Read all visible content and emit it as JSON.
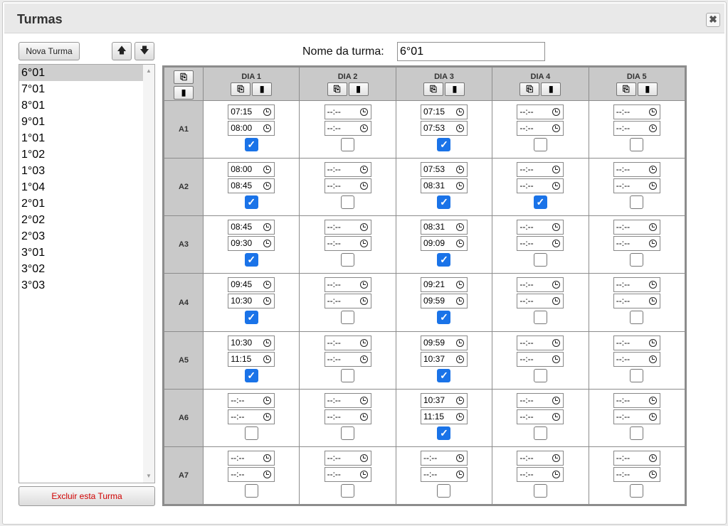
{
  "dialog": {
    "title": "Turmas",
    "close_icon": "✖"
  },
  "buttons": {
    "nova": "Nova Turma",
    "up": "🡅",
    "down": "🡇",
    "excluir": "Excluir esta Turma"
  },
  "list": {
    "items": [
      "6°01",
      "7°01",
      "8°01",
      "9°01",
      "1°01",
      "1°02",
      "1°03",
      "1°04",
      "2°01",
      "2°02",
      "2°03",
      "3°01",
      "3°02",
      "3°03"
    ],
    "selected_index": 0
  },
  "nome": {
    "label": "Nome da turma:",
    "value": "6°01"
  },
  "icons": {
    "copy": "⎘",
    "paste": "▮",
    "scroll_up": "▲",
    "scroll_down": "▼"
  },
  "colors": {
    "checkbox_checked": "#1a73e8",
    "header_bg": "#c9c9c9",
    "delete_text": "#d00000"
  },
  "grid": {
    "days": [
      "DIA 1",
      "DIA 2",
      "DIA 3",
      "DIA 4",
      "DIA 5"
    ],
    "rows": [
      {
        "label": "A1",
        "cells": [
          {
            "start": "07:15",
            "end": "08:00",
            "checked": true
          },
          {
            "start": "--:--",
            "end": "--:--",
            "checked": false
          },
          {
            "start": "07:15",
            "end": "07:53",
            "checked": true
          },
          {
            "start": "--:--",
            "end": "--:--",
            "checked": false
          },
          {
            "start": "--:--",
            "end": "--:--",
            "checked": false
          }
        ]
      },
      {
        "label": "A2",
        "cells": [
          {
            "start": "08:00",
            "end": "08:45",
            "checked": true
          },
          {
            "start": "--:--",
            "end": "--:--",
            "checked": false
          },
          {
            "start": "07:53",
            "end": "08:31",
            "checked": true
          },
          {
            "start": "--:--",
            "end": "--:--",
            "checked": true
          },
          {
            "start": "--:--",
            "end": "--:--",
            "checked": false
          }
        ]
      },
      {
        "label": "A3",
        "cells": [
          {
            "start": "08:45",
            "end": "09:30",
            "checked": true
          },
          {
            "start": "--:--",
            "end": "--:--",
            "checked": false
          },
          {
            "start": "08:31",
            "end": "09:09",
            "checked": true
          },
          {
            "start": "--:--",
            "end": "--:--",
            "checked": false
          },
          {
            "start": "--:--",
            "end": "--:--",
            "checked": false
          }
        ]
      },
      {
        "label": "A4",
        "cells": [
          {
            "start": "09:45",
            "end": "10:30",
            "checked": true
          },
          {
            "start": "--:--",
            "end": "--:--",
            "checked": false
          },
          {
            "start": "09:21",
            "end": "09:59",
            "checked": true
          },
          {
            "start": "--:--",
            "end": "--:--",
            "checked": false
          },
          {
            "start": "--:--",
            "end": "--:--",
            "checked": false
          }
        ]
      },
      {
        "label": "A5",
        "cells": [
          {
            "start": "10:30",
            "end": "11:15",
            "checked": true
          },
          {
            "start": "--:--",
            "end": "--:--",
            "checked": false
          },
          {
            "start": "09:59",
            "end": "10:37",
            "checked": true
          },
          {
            "start": "--:--",
            "end": "--:--",
            "checked": false
          },
          {
            "start": "--:--",
            "end": "--:--",
            "checked": false
          }
        ]
      },
      {
        "label": "A6",
        "cells": [
          {
            "start": "--:--",
            "end": "--:--",
            "checked": false
          },
          {
            "start": "--:--",
            "end": "--:--",
            "checked": false
          },
          {
            "start": "10:37",
            "end": "11:15",
            "checked": true
          },
          {
            "start": "--:--",
            "end": "--:--",
            "checked": false
          },
          {
            "start": "--:--",
            "end": "--:--",
            "checked": false
          }
        ]
      },
      {
        "label": "A7",
        "cells": [
          {
            "start": "--:--",
            "end": "--:--",
            "checked": false
          },
          {
            "start": "--:--",
            "end": "--:--",
            "checked": false
          },
          {
            "start": "--:--",
            "end": "--:--",
            "checked": false
          },
          {
            "start": "--:--",
            "end": "--:--",
            "checked": false
          },
          {
            "start": "--:--",
            "end": "--:--",
            "checked": false
          }
        ]
      }
    ]
  }
}
